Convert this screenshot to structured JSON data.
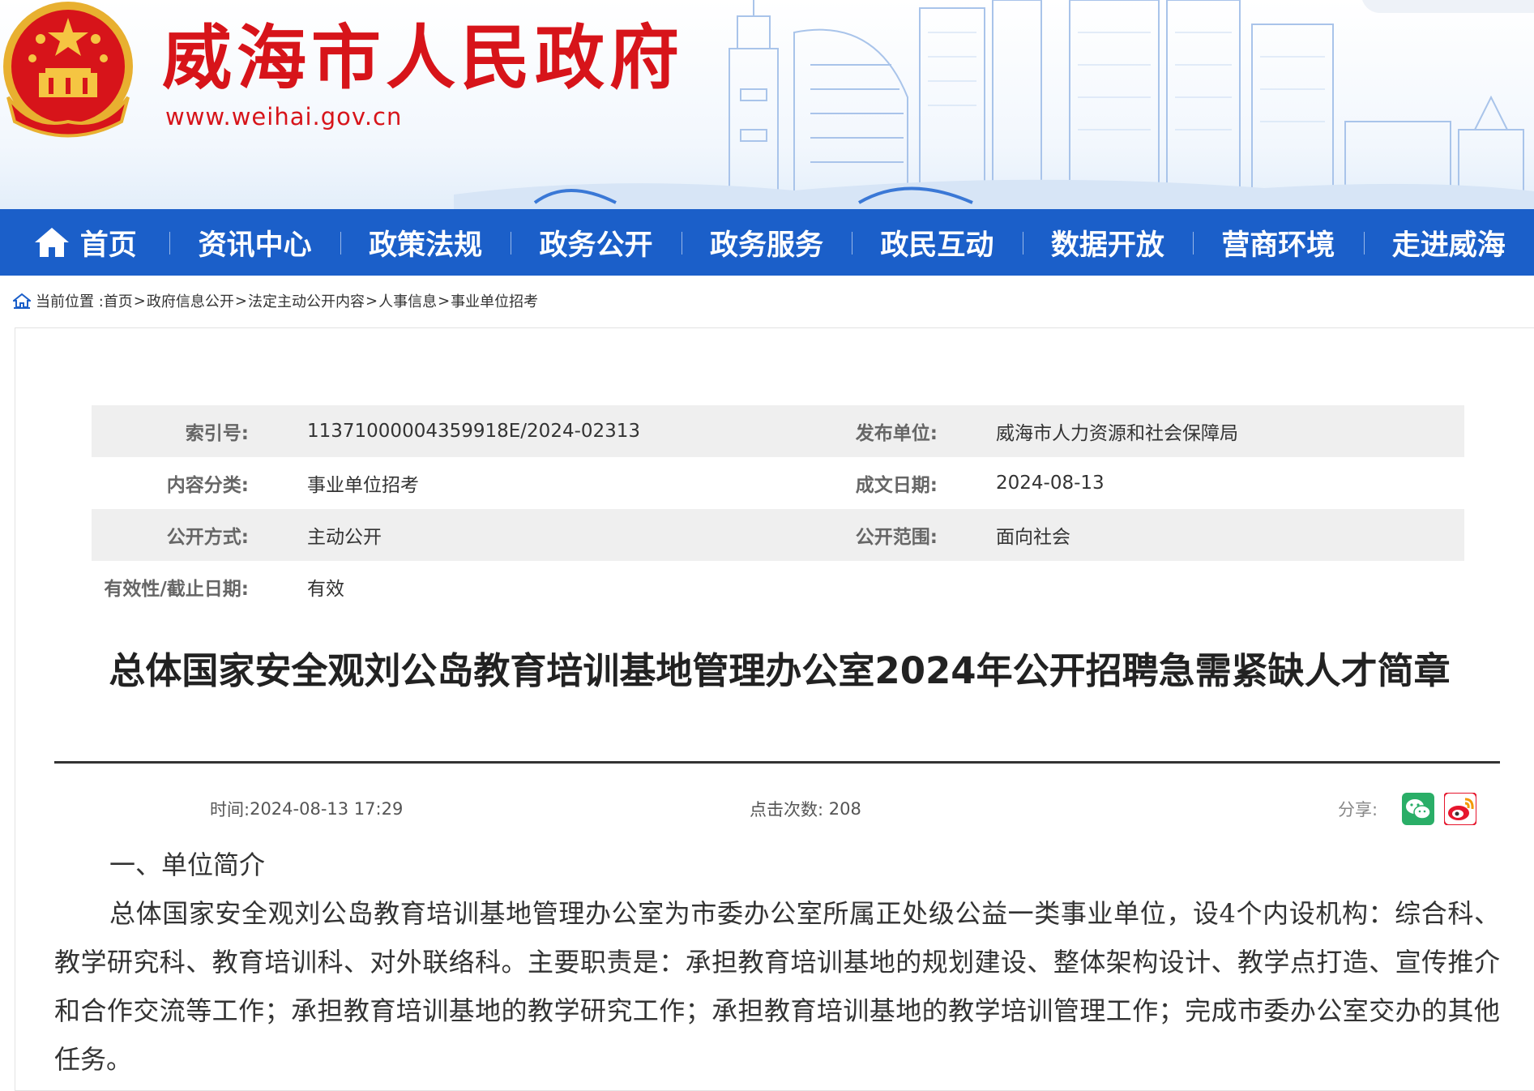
{
  "header": {
    "site_title": "威海市人民政府",
    "site_url": "www.weihai.gov.cn",
    "emblem_icon": "national-emblem-icon",
    "brand_color": "#d7141a"
  },
  "nav": {
    "color": "#1b5fc9",
    "home_icon": "home-icon",
    "items": [
      {
        "label": "首页"
      },
      {
        "label": "资讯中心"
      },
      {
        "label": "政策法规"
      },
      {
        "label": "政务公开"
      },
      {
        "label": "政务服务"
      },
      {
        "label": "政民互动"
      },
      {
        "label": "数据开放"
      },
      {
        "label": "营商环境"
      },
      {
        "label": "走进威海"
      }
    ]
  },
  "breadcrumb": {
    "prefix": "当前位置 :",
    "items": [
      "首页",
      "政府信息公开",
      "法定主动公开内容",
      "人事信息",
      "事业单位招考"
    ],
    "separator": ">"
  },
  "meta": {
    "rows": [
      {
        "l1": "索引号:",
        "v1": "11371000004359918E/2024-02313",
        "l2": "发布单位:",
        "v2": "威海市人力资源和社会保障局"
      },
      {
        "l1": "内容分类:",
        "v1": "事业单位招考",
        "l2": "成文日期:",
        "v2": "2024-08-13"
      },
      {
        "l1": "公开方式:",
        "v1": "主动公开",
        "l2": "公开范围:",
        "v2": "面向社会"
      },
      {
        "l1": "有效性/截止日期:",
        "v1": "有效",
        "l2": "",
        "v2": ""
      }
    ]
  },
  "article": {
    "title": "总体国家安全观刘公岛教育培训基地管理办公室2024年公开招聘急需紧缺人才简章",
    "time_label": "时间:",
    "time_value": "2024-08-13 17:29",
    "clicks_label": "点击次数:",
    "clicks_value": "208",
    "share_label": "分享:",
    "share_icons": [
      "wechat-icon",
      "weibo-icon"
    ],
    "section1_heading": "一、单位简介",
    "section1_body": "总体国家安全观刘公岛教育培训基地管理办公室为市委办公室所属正处级公益一类事业单位，设4个内设机构：综合科、教学研究科、教育培训科、对外联络科。主要职责是：承担教育培训基地的规划建设、整体架构设计、教学点打造、宣传推介和合作交流等工作；承担教育培训基地的教学研究工作；承担教育培训基地的教学培训管理工作；完成市委办公室交办的其他任务。"
  }
}
